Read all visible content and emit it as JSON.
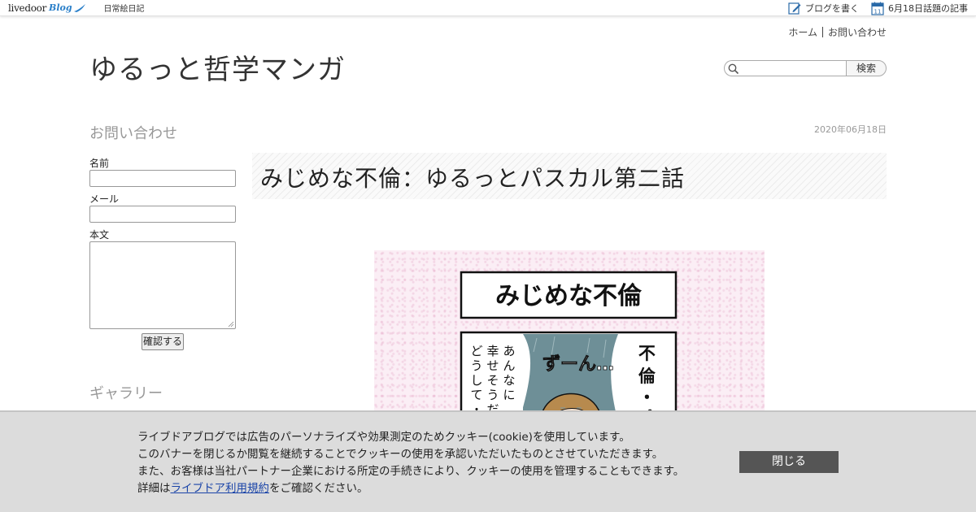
{
  "topbar": {
    "logo_text": "livedoor",
    "logo_blog": "Blog",
    "blog_tag": "日常絵日記",
    "write_blog": "ブログを書く",
    "topic_date_icon": "11",
    "topic_link": "6月18日話題の記事"
  },
  "header": {
    "nav_home": "ホーム",
    "nav_contact": "お問い合わせ",
    "site_title": "ゆるっと哲学マンガ",
    "search_placeholder": "",
    "search_button": "検索"
  },
  "sidebar": {
    "contact_heading": "お問い合わせ",
    "name_label": "名前",
    "mail_label": "メール",
    "body_label": "本文",
    "submit_label": "確認する",
    "gallery_heading": "ギャラリー"
  },
  "post": {
    "date": "2020年06月18日",
    "title": "みじめな不倫：ゆるっとパスカル第二話"
  },
  "manga": {
    "panel_title": "みじめな不倫",
    "sfx": "ずーん…",
    "right_caption": "不倫・・",
    "left_caption_col1": "あんなに",
    "left_caption_col2": "幸せそうだ",
    "left_caption_col3": "どうして・"
  },
  "cookie": {
    "line1": "ライブドアブログでは広告のパーソナライズや効果測定のためクッキー(cookie)を使用しています。",
    "line2": "このバナーを閉じるか閲覧を継続することでクッキーの使用を承認いただいたものとさせていただきます。",
    "line3": "また、お客様は当社パートナー企業における所定の手続きにより、クッキーの使用を管理することもできます。",
    "line4_prefix": "詳細は",
    "line4_link": "ライブドア利用規約",
    "line4_suffix": "をご確認ください。",
    "close_label": "閉じる"
  },
  "colors": {
    "accent_blue": "#2a7fc9",
    "banner_bg": "#dcdcdc",
    "close_bg": "#555555"
  }
}
